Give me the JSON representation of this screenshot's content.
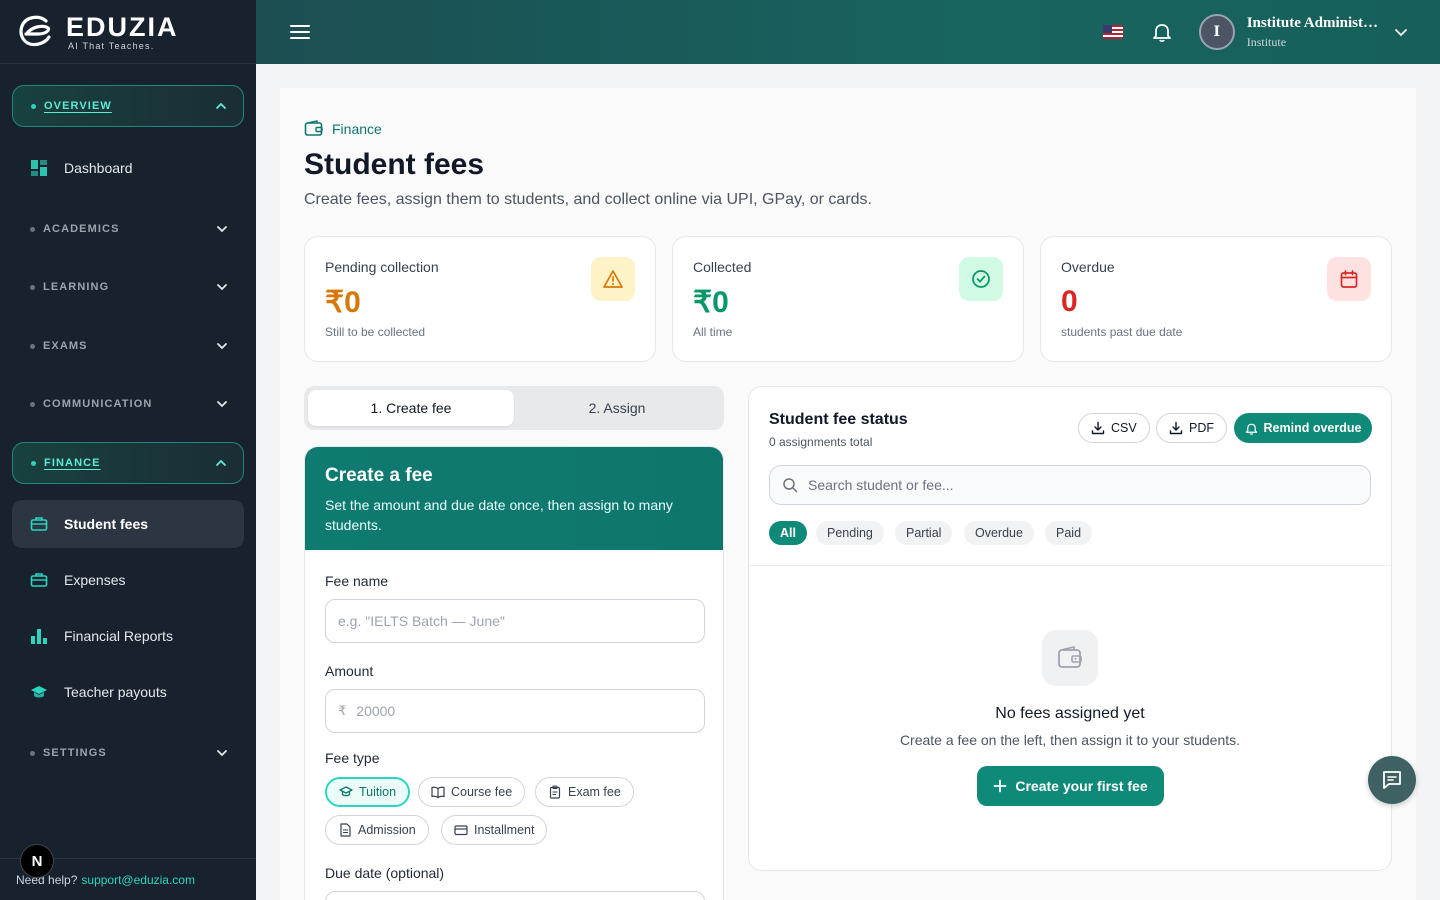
{
  "brand": {
    "name": "EDUZIA",
    "tagline": "AI That Teaches."
  },
  "sidebar": {
    "sections": [
      {
        "label": "OVERVIEW",
        "open": true
      },
      {
        "label": "ACADEMICS",
        "open": false
      },
      {
        "label": "LEARNING",
        "open": false
      },
      {
        "label": "EXAMS",
        "open": false
      },
      {
        "label": "COMMUNICATION",
        "open": false
      },
      {
        "label": "FINANCE",
        "open": true
      },
      {
        "label": "SETTINGS",
        "open": false
      }
    ],
    "items": {
      "dashboard": "Dashboard",
      "student_fees": "Student fees",
      "expenses": "Expenses",
      "financial_reports": "Financial Reports",
      "teacher_payouts": "Teacher payouts"
    },
    "footer": {
      "help": "Need help?",
      "email": "support@eduzia.com"
    },
    "badge": "N"
  },
  "topbar": {
    "user_initial": "I",
    "user_name": "Institute Administ…",
    "user_role": "Institute"
  },
  "page": {
    "breadcrumb": "Finance",
    "title": "Student fees",
    "subtitle": "Create fees, assign them to students, and collect online via UPI, GPay, or cards."
  },
  "stats": [
    {
      "label": "Pending collection",
      "value": "₹0",
      "note": "Still to be collected",
      "color": "#d97706"
    },
    {
      "label": "Collected",
      "value": "₹0",
      "note": "All time",
      "color": "#059669"
    },
    {
      "label": "Overdue",
      "value": "0",
      "note": "students past due date",
      "color": "#dc2626"
    }
  ],
  "tabs": {
    "create": "1. Create fee",
    "assign": "2. Assign"
  },
  "create_fee": {
    "title": "Create a fee",
    "subtitle": "Set the amount and due date once, then assign to many students.",
    "fee_name_label": "Fee name",
    "fee_name_placeholder": "e.g. \"IELTS Batch — June\"",
    "amount_label": "Amount",
    "amount_currency": "₹",
    "amount_placeholder": "20000",
    "fee_type_label": "Fee type",
    "fee_types": [
      "Tuition",
      "Course fee",
      "Exam fee",
      "Admission",
      "Installment"
    ],
    "due_date_label": "Due date (optional)"
  },
  "status": {
    "title": "Student fee status",
    "subtitle": "0 assignments total",
    "csv": "CSV",
    "pdf": "PDF",
    "remind": "Remind overdue",
    "search_placeholder": "Search student or fee...",
    "filters": [
      "All",
      "Pending",
      "Partial",
      "Overdue",
      "Paid"
    ],
    "empty_title": "No fees assigned yet",
    "empty_sub": "Create a fee on the left, then assign it to your students.",
    "empty_button": "Create your first fee"
  },
  "colors": {
    "accent": "#0f8a78",
    "sidebar": "#18222e",
    "topbar": "#18645f"
  }
}
